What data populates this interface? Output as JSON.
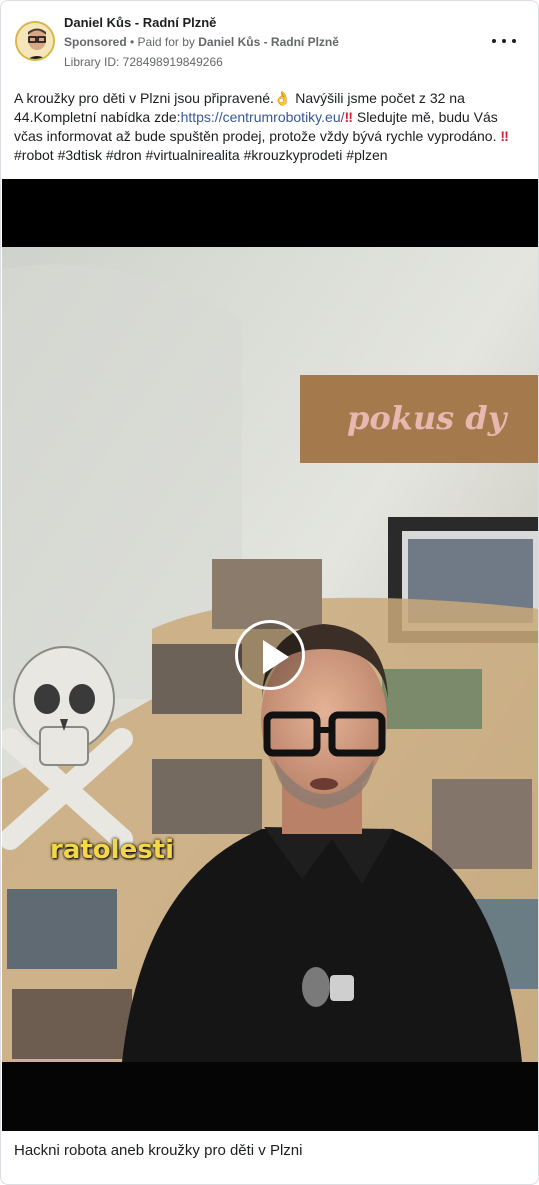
{
  "ad": {
    "advertiser_name": "Daniel Kůs - Radní Plzně",
    "sponsored_label": "Sponsored",
    "separator": " • ",
    "paid_for_prefix": "Paid for by ",
    "paid_for_name": "Daniel Kůs - Radní Plzně",
    "library_id": "Library ID: 728498919849266"
  },
  "post": {
    "text_1": "A kroužky pro děti v Plzni jsou připravené.",
    "emoji_1": "👌",
    "text_2": " Navýšili jsme počet z 32 na 44.Kompletní nabídka zde:",
    "link": "https://centrumrobotiky.eu/",
    "emoji_2": "‼",
    "text_3": " Sledujte mě, budu Vás včas informovat až bude spuštěn prodej, protože vždy bývá rychle vyprodáno. ",
    "emoji_3": "‼",
    "hashtags": "#robot #3dtisk #dron #virtualnirealita #krouzkyprodeti #plzen"
  },
  "video": {
    "subtitle": "ratolesti",
    "play_icon": "play-icon"
  },
  "footer": {
    "title": "Hackni robota aneb kroužky pro děti v Plzni"
  },
  "colors": {
    "link": "#385898",
    "subtitle": "#f3d64a",
    "text": "#1c1e21",
    "secondary": "#65676b"
  }
}
